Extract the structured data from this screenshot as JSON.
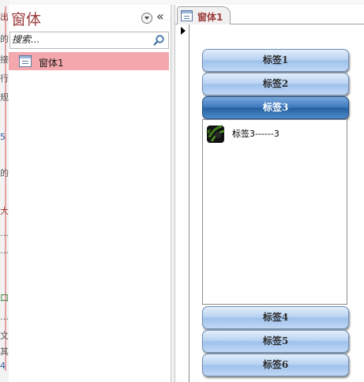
{
  "left_fragments": [
    "出",
    "的",
    "接",
    "行",
    "规",
    "5",
    "的",
    "大",
    "…",
    "…",
    "口",
    "…",
    "文",
    "其",
    "4"
  ],
  "nav_pane": {
    "title": "窗体",
    "collapse_glyph": "«",
    "search": {
      "placeholder": "搜索..."
    },
    "items": [
      {
        "label": "窗体1",
        "selected": true
      }
    ]
  },
  "document": {
    "tab_label": "窗体1",
    "buttons": [
      {
        "label": "标签1",
        "active": false
      },
      {
        "label": "标签2",
        "active": false
      },
      {
        "label": "标签3",
        "active": true
      },
      {
        "label": "标签4",
        "active": false
      },
      {
        "label": "标签5",
        "active": false
      },
      {
        "label": "标签6",
        "active": false
      }
    ],
    "content": {
      "text": "标签3------3"
    }
  },
  "colors": {
    "title_red": "#9e3c3c",
    "selected_row_pink": "#f4a8ad",
    "active_button_blue": "#25609f",
    "inactive_button_blue": "#b7d1f1"
  }
}
